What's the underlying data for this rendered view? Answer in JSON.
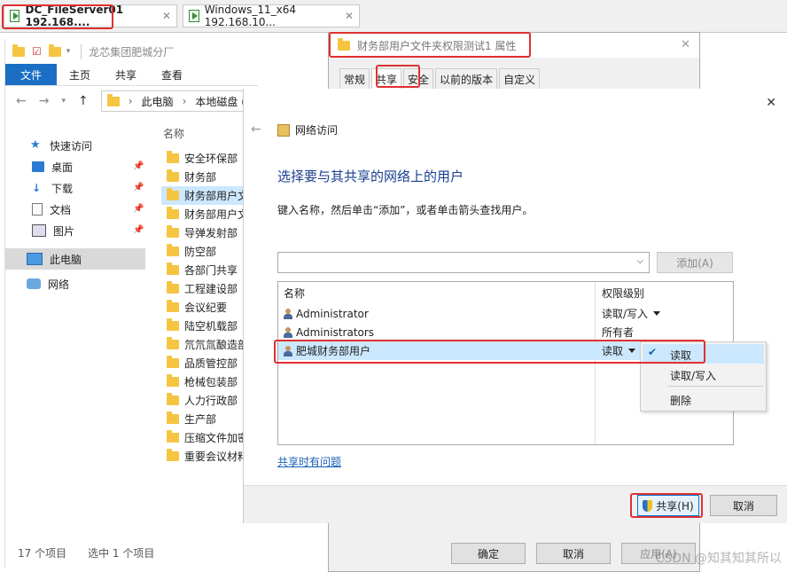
{
  "vm_tabs": [
    {
      "label": "DC_FileServer01 192.168...."
    },
    {
      "label": "Windows_11_x64 192.168.10..."
    }
  ],
  "explorer": {
    "title": "龙芯集团肥城分厂",
    "ribbon": {
      "file": "文件",
      "home": "主页",
      "share": "共享",
      "view": "查看"
    },
    "breadcrumb": {
      "pc": "此电脑",
      "disk": "本地磁盘 (("
    },
    "nav": {
      "quick_access": "快速访问",
      "desktop": "桌面",
      "downloads": "下载",
      "documents": "文档",
      "pictures": "图片",
      "this_pc": "此电脑",
      "network": "网络"
    },
    "column_name": "名称",
    "folders": [
      "安全环保部",
      "财务部",
      "财务部用户文",
      "财务部用户文",
      "导弹发射部",
      "防空部",
      "各部门共享",
      "工程建设部",
      "会议纪要",
      "陆空机载部",
      "氘氘氚酿造部",
      "品质管控部",
      "枪械包装部",
      "人力行政部",
      "生产部",
      "压缩文件加密",
      "重要会议材料"
    ],
    "status_count": "17 个项目",
    "status_selected": "选中 1 个项目"
  },
  "properties": {
    "title": "财务部用户文件夹权限测试1 属性",
    "tabs": [
      "常规",
      "共享",
      "安全",
      "以前的版本",
      "自定义"
    ],
    "ok": "确定",
    "cancel": "取消",
    "apply": "应用(A)"
  },
  "network_access": {
    "header": "网络访问",
    "heading": "选择要与其共享的网络上的用户",
    "instruction": "键入名称，然后单击“添加”，或者单击箭头查找用户。",
    "add_button": "添加(A)",
    "col_name": "名称",
    "col_permission": "权限级别",
    "rows": [
      {
        "name": "Administrator",
        "permission": "读取/写入"
      },
      {
        "name": "Administrators",
        "permission": "所有者"
      },
      {
        "name": "肥城财务部用户",
        "permission": "读取"
      }
    ],
    "menu": {
      "read": "读取",
      "read_write": "读取/写入",
      "remove": "删除"
    },
    "trouble_link": "共享时有问题",
    "share_button": "共享(H)",
    "cancel_button": "取消"
  },
  "watermark": "CSDN @知其知其所以"
}
